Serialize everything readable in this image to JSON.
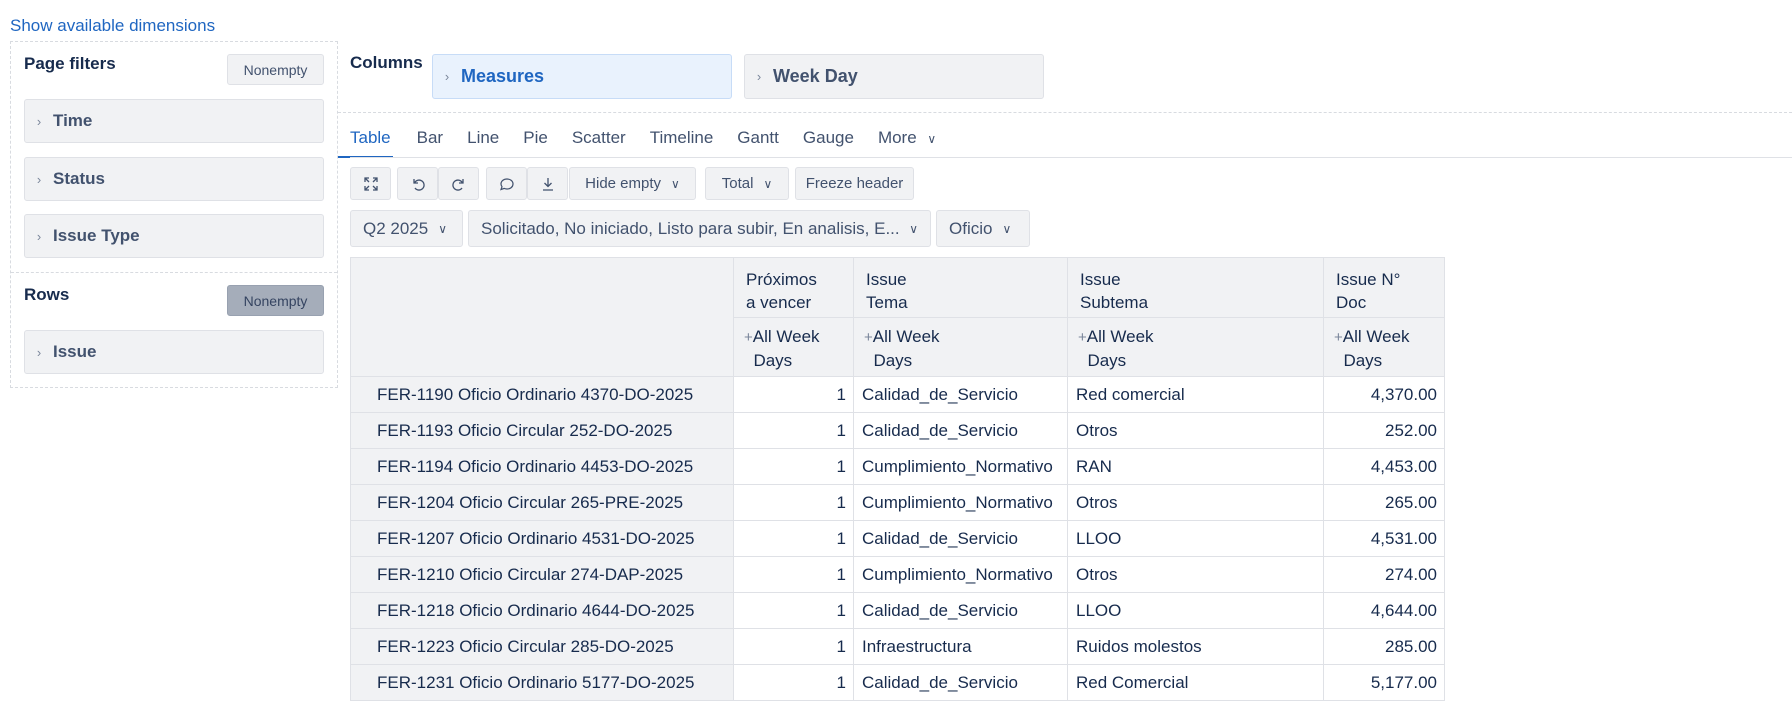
{
  "top_link": "Show available dimensions",
  "page_filters": {
    "title": "Page filters",
    "nonempty_label": "Nonempty",
    "items": [
      "Time",
      "Status",
      "Issue Type"
    ]
  },
  "rows_section": {
    "title": "Rows",
    "nonempty_label": "Nonempty",
    "items": [
      "Issue"
    ]
  },
  "columns_section": {
    "title": "Columns",
    "chips": [
      "Measures",
      "Week Day"
    ]
  },
  "view_tabs": [
    "Table",
    "Bar",
    "Line",
    "Pie",
    "Scatter",
    "Timeline",
    "Gantt",
    "Gauge",
    "More"
  ],
  "active_tab": "Table",
  "toolbar": {
    "hide_empty": "Hide empty",
    "total": "Total",
    "freeze_header": "Freeze header"
  },
  "selectors": {
    "time": "Q2 2025",
    "status": "Solicitado, No iniciado, Listo para subir, En analisis, E...",
    "issue_type": "Oficio"
  },
  "table": {
    "headers": [
      {
        "line1": "Próximos",
        "line2": "a vencer"
      },
      {
        "line1": "Issue",
        "line2": "Tema"
      },
      {
        "line1": "Issue",
        "line2": "Subtema"
      },
      {
        "line1": "Issue N°",
        "line2": "Doc"
      }
    ],
    "subheader_line1": "All Week",
    "subheader_line2": "Days",
    "rows": [
      {
        "issue": "FER-1190 Oficio Ordinario 4370-DO-2025",
        "proximos": "1",
        "tema": "Calidad_de_Servicio",
        "subtema": "Red comercial",
        "doc": "4,370.00"
      },
      {
        "issue": "FER-1193 Oficio Circular 252-DO-2025",
        "proximos": "1",
        "tema": "Calidad_de_Servicio",
        "subtema": "Otros",
        "doc": "252.00"
      },
      {
        "issue": "FER-1194 Oficio Ordinario 4453-DO-2025",
        "proximos": "1",
        "tema": "Cumplimiento_Normativo",
        "subtema": "RAN",
        "doc": "4,453.00"
      },
      {
        "issue": "FER-1204 Oficio Circular 265-PRE-2025",
        "proximos": "1",
        "tema": "Cumplimiento_Normativo",
        "subtema": "Otros",
        "doc": "265.00"
      },
      {
        "issue": "FER-1207 Oficio Ordinario 4531-DO-2025",
        "proximos": "1",
        "tema": "Calidad_de_Servicio",
        "subtema": "LLOO",
        "doc": "4,531.00"
      },
      {
        "issue": "FER-1210 Oficio Circular 274-DAP-2025",
        "proximos": "1",
        "tema": "Cumplimiento_Normativo",
        "subtema": "Otros",
        "doc": "274.00"
      },
      {
        "issue": "FER-1218 Oficio Ordinario 4644-DO-2025",
        "proximos": "1",
        "tema": "Calidad_de_Servicio",
        "subtema": "LLOO",
        "doc": "4,644.00"
      },
      {
        "issue": "FER-1223 Oficio Circular 285-DO-2025",
        "proximos": "1",
        "tema": "Infraestructura",
        "subtema": "Ruidos molestos",
        "doc": "285.00"
      },
      {
        "issue": "FER-1231 Oficio Ordinario 5177-DO-2025",
        "proximos": "1",
        "tema": "Calidad_de_Servicio",
        "subtema": "Red Comercial",
        "doc": "5,177.00"
      }
    ]
  }
}
